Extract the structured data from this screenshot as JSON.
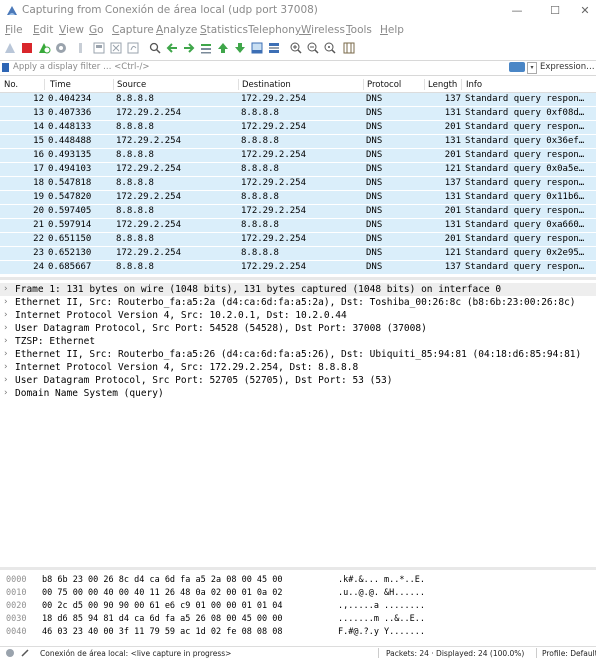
{
  "window": {
    "title": "Capturing from Conexión de área local (udp port 37008)",
    "minimize_glyph": "—",
    "maximize_glyph": "☐",
    "close_glyph": "✕"
  },
  "menu": [
    {
      "key": "F",
      "rest": "ile"
    },
    {
      "key": "E",
      "rest": "dit"
    },
    {
      "key": "V",
      "rest": "iew"
    },
    {
      "key": "G",
      "rest": "o"
    },
    {
      "key": "C",
      "rest": "apture"
    },
    {
      "key": "A",
      "rest": "nalyze"
    },
    {
      "key": "S",
      "rest": "tatistics"
    },
    {
      "pre": "Telephon",
      "key": "y",
      "rest": ""
    },
    {
      "key": "W",
      "rest": "ireless"
    },
    {
      "key": "T",
      "rest": "ools"
    },
    {
      "key": "H",
      "rest": "elp"
    }
  ],
  "toolbar_icons": [
    "shark-fin-icon",
    "stop-icon",
    "restart-icon",
    "options-icon",
    "open-icon",
    "save-icon",
    "close-file-icon",
    "reload-icon",
    "find-icon",
    "back-icon",
    "forward-icon",
    "goto-icon",
    "first-icon",
    "last-icon",
    "autoscroll-icon",
    "colorize-icon",
    "zoom-in-icon",
    "zoom-out-icon",
    "zoom-normal-icon",
    "resize-columns-icon"
  ],
  "filter": {
    "placeholder": "Apply a display filter … <Ctrl-/>",
    "expression_label": "Expression…"
  },
  "packet_list": {
    "columns": [
      "No.",
      "Time",
      "Source",
      "Destination",
      "Protocol",
      "Length",
      "Info"
    ],
    "rows": [
      {
        "no": "12",
        "time": "0.404234",
        "src": "8.8.8.8",
        "dst": "172.29.2.254",
        "proto": "DNS",
        "len": "137",
        "info": "Standard query respon…"
      },
      {
        "no": "13",
        "time": "0.407336",
        "src": "172.29.2.254",
        "dst": "8.8.8.8",
        "proto": "DNS",
        "len": "131",
        "info": "Standard query 0xf08d…"
      },
      {
        "no": "14",
        "time": "0.448133",
        "src": "8.8.8.8",
        "dst": "172.29.2.254",
        "proto": "DNS",
        "len": "201",
        "info": "Standard query respon…"
      },
      {
        "no": "15",
        "time": "0.448488",
        "src": "172.29.2.254",
        "dst": "8.8.8.8",
        "proto": "DNS",
        "len": "131",
        "info": "Standard query 0x36ef…"
      },
      {
        "no": "16",
        "time": "0.493135",
        "src": "8.8.8.8",
        "dst": "172.29.2.254",
        "proto": "DNS",
        "len": "201",
        "info": "Standard query respon…"
      },
      {
        "no": "17",
        "time": "0.494103",
        "src": "172.29.2.254",
        "dst": "8.8.8.8",
        "proto": "DNS",
        "len": "121",
        "info": "Standard query 0x0a5e…"
      },
      {
        "no": "18",
        "time": "0.547818",
        "src": "8.8.8.8",
        "dst": "172.29.2.254",
        "proto": "DNS",
        "len": "137",
        "info": "Standard query respon…"
      },
      {
        "no": "19",
        "time": "0.547820",
        "src": "172.29.2.254",
        "dst": "8.8.8.8",
        "proto": "DNS",
        "len": "131",
        "info": "Standard query 0x11b6…"
      },
      {
        "no": "20",
        "time": "0.597405",
        "src": "8.8.8.8",
        "dst": "172.29.2.254",
        "proto": "DNS",
        "len": "201",
        "info": "Standard query respon…"
      },
      {
        "no": "21",
        "time": "0.597914",
        "src": "172.29.2.254",
        "dst": "8.8.8.8",
        "proto": "DNS",
        "len": "131",
        "info": "Standard query 0xa660…"
      },
      {
        "no": "22",
        "time": "0.651150",
        "src": "8.8.8.8",
        "dst": "172.29.2.254",
        "proto": "DNS",
        "len": "201",
        "info": "Standard query respon…"
      },
      {
        "no": "23",
        "time": "0.652130",
        "src": "172.29.2.254",
        "dst": "8.8.8.8",
        "proto": "DNS",
        "len": "121",
        "info": "Standard query 0x2e95…"
      },
      {
        "no": "24",
        "time": "0.685667",
        "src": "8.8.8.8",
        "dst": "172.29.2.254",
        "proto": "DNS",
        "len": "137",
        "info": "Standard query respon…"
      }
    ],
    "row_color": "#daeefa"
  },
  "details": {
    "items": [
      "Frame 1: 131 bytes on wire (1048 bits), 131 bytes captured (1048 bits) on interface 0",
      "Ethernet II, Src: Routerbo_fa:a5:2a (d4:ca:6d:fa:a5:2a), Dst: Toshiba_00:26:8c (b8:6b:23:00:26:8c)",
      "Internet Protocol Version 4, Src: 10.2.0.1, Dst: 10.2.0.44",
      "User Datagram Protocol, Src Port: 54528 (54528), Dst Port: 37008 (37008)",
      "TZSP: Ethernet",
      "Ethernet II, Src: Routerbo_fa:a5:26 (d4:ca:6d:fa:a5:26), Dst: Ubiquiti_85:94:81 (04:18:d6:85:94:81)",
      "Internet Protocol Version 4, Src: 172.29.2.254, Dst: 8.8.8.8",
      "User Datagram Protocol, Src Port: 52705 (52705), Dst Port: 53 (53)",
      "Domain Name System (query)"
    ],
    "expander_glyph": "›"
  },
  "hex": {
    "rows": [
      {
        "off": "0000",
        "hex": "b8 6b 23 00 26 8c d4 ca  6d fa a5 2a 08 00 45 00",
        "ascii": ".k#.&... m..*..E."
      },
      {
        "off": "0010",
        "hex": "00 75 00 00 40 00 40 11  26 48 0a 02 00 01 0a 02",
        "ascii": ".u..@.@. &H......"
      },
      {
        "off": "0020",
        "hex": "00 2c d5 00 90 90 00 61  e6 c9 01 00 00 01 01 04",
        "ascii": ".,.....a ........"
      },
      {
        "off": "0030",
        "hex": "18 d6 85 94 81 d4 ca 6d  fa a5 26 08 00 45 00 00",
        "ascii": ".......m ..&..E.."
      },
      {
        "off": "0040",
        "hex": "46 03 23 40 00 3f 11 79  59 ac 1d 02 fe 08 08 08",
        "ascii": "F.#@.?.y Y......."
      }
    ]
  },
  "status": {
    "interface_text": "Conexión de área local: <live capture in progress>",
    "packets_text": "Packets: 24 · Displayed: 24 (100.0%)",
    "profile_text": "Profile: Default"
  },
  "colors": {
    "stop_red": "#d9262b",
    "shark_blue": "#3d6fb5",
    "restart_green": "#38a93a",
    "arrow_green": "#3fa64a",
    "filter_blue": "#2e66b5"
  }
}
